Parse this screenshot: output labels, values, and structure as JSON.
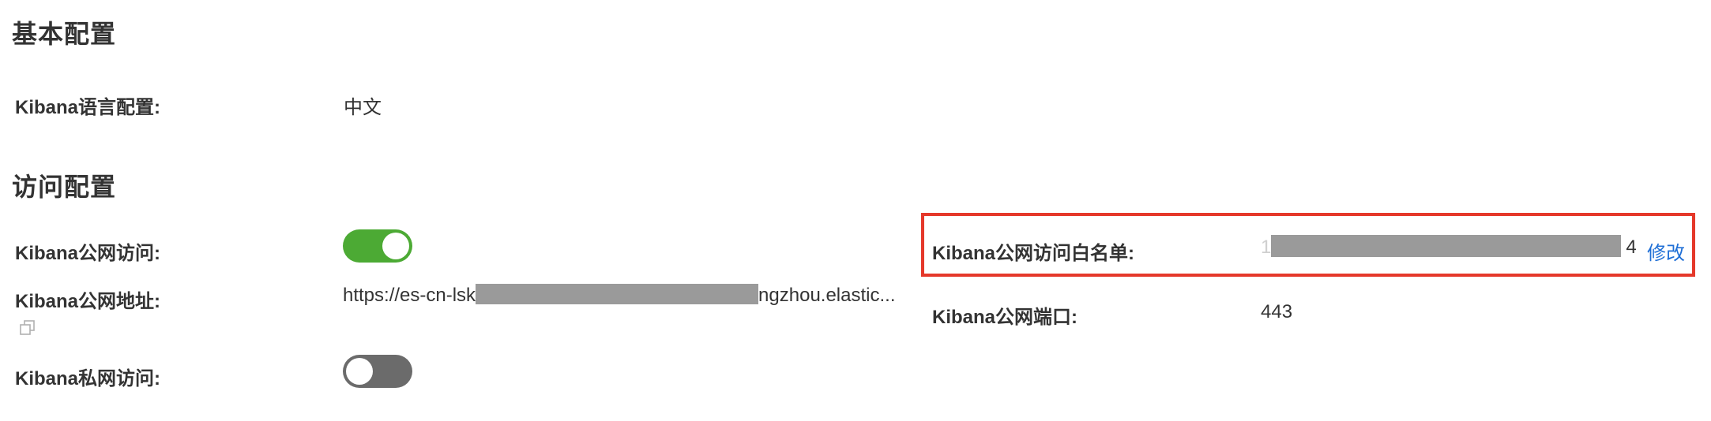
{
  "basic": {
    "title": "基本配置",
    "language_label": "Kibana语言配置:",
    "language_value": "中文"
  },
  "access": {
    "title": "访问配置",
    "public_access_label": "Kibana公网访问:",
    "public_access_enabled": true,
    "public_address_label": "Kibana公网地址:",
    "public_address_prefix": "https://es-cn-lsk",
    "public_address_suffix": "ngzhou.elastic...",
    "private_access_label": "Kibana私网访问:",
    "private_access_enabled": false,
    "whitelist_label": "Kibana公网访问白名单:",
    "whitelist_value_start": "1",
    "whitelist_value_end": "4",
    "modify_label": "修改",
    "port_label": "Kibana公网端口:",
    "port_value": "443"
  },
  "colors": {
    "toggle_on": "#4caa34",
    "toggle_off": "#6b6b6b",
    "highlight": "#e5382a",
    "link": "#1f6fd6"
  },
  "icons": {
    "copy": "copy-icon"
  }
}
